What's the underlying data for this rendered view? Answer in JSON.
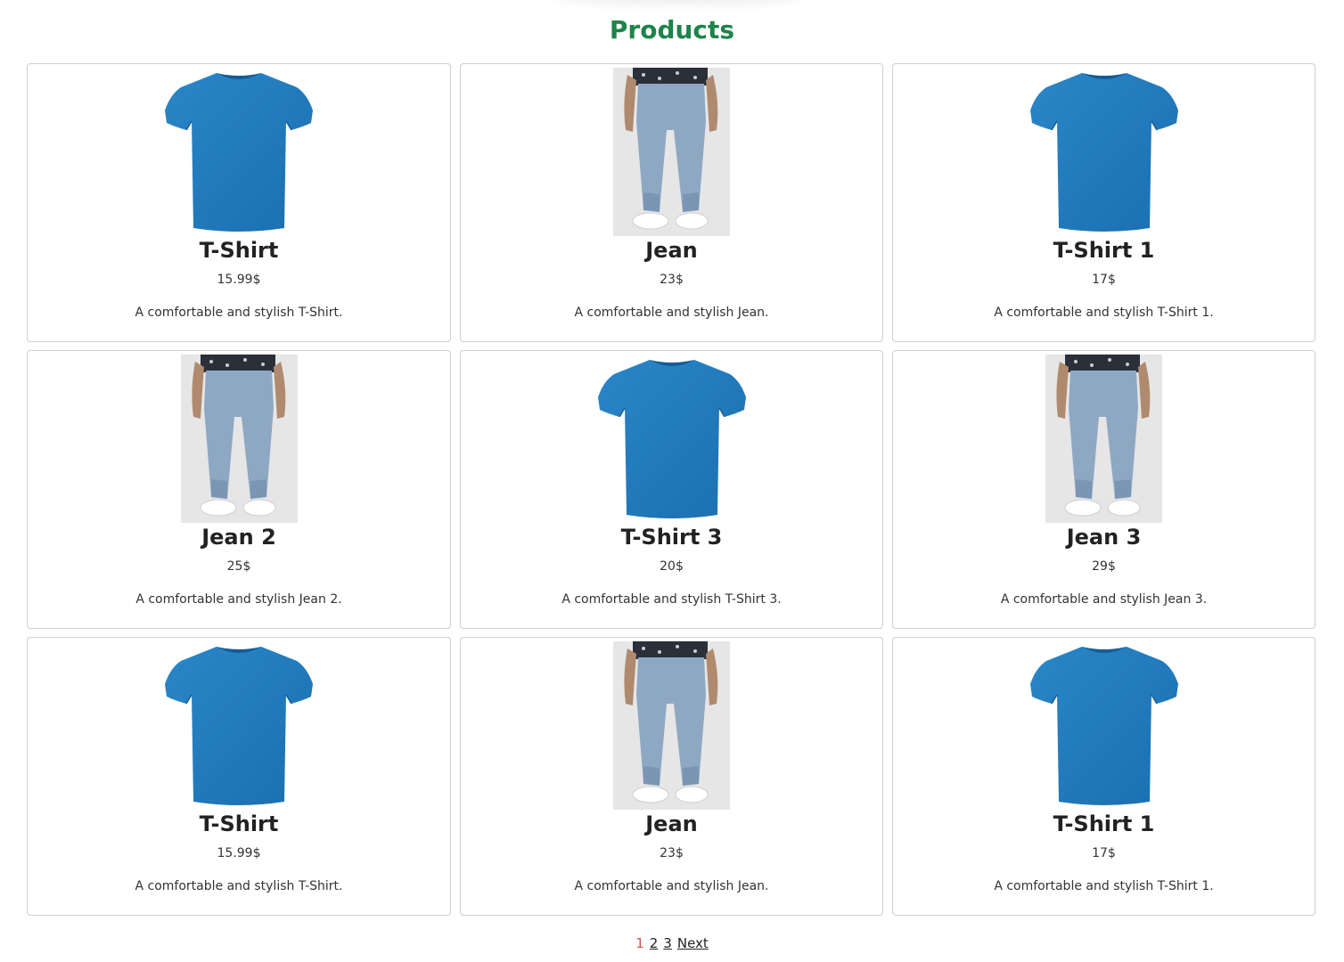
{
  "page": {
    "title": "Products",
    "title_color": "#1e8449"
  },
  "products": [
    {
      "name": "T-Shirt",
      "price": "15.99$",
      "description": "A comfortable and stylish T-Shirt.",
      "image": "tshirt-image"
    },
    {
      "name": "Jean",
      "price": "23$",
      "description": "A comfortable and stylish Jean.",
      "image": "jean-image"
    },
    {
      "name": "T-Shirt 1",
      "price": "17$",
      "description": "A comfortable and stylish T-Shirt 1.",
      "image": "tshirt-image"
    },
    {
      "name": "Jean 2",
      "price": "25$",
      "description": "A comfortable and stylish Jean 2.",
      "image": "jean-image"
    },
    {
      "name": "T-Shirt 3",
      "price": "20$",
      "description": "A comfortable and stylish T-Shirt 3.",
      "image": "tshirt-image"
    },
    {
      "name": "Jean 3",
      "price": "29$",
      "description": "A comfortable and stylish Jean 3.",
      "image": "jean-image"
    },
    {
      "name": "T-Shirt",
      "price": "15.99$",
      "description": "A comfortable and stylish T-Shirt.",
      "image": "tshirt-image"
    },
    {
      "name": "Jean",
      "price": "23$",
      "description": "A comfortable and stylish Jean.",
      "image": "jean-image"
    },
    {
      "name": "T-Shirt 1",
      "price": "17$",
      "description": "A comfortable and stylish T-Shirt 1.",
      "image": "tshirt-image"
    }
  ],
  "pagination": {
    "pages": [
      "1",
      "2",
      "3"
    ],
    "current": "1",
    "next_label": "Next",
    "current_color": "#d9534f"
  }
}
